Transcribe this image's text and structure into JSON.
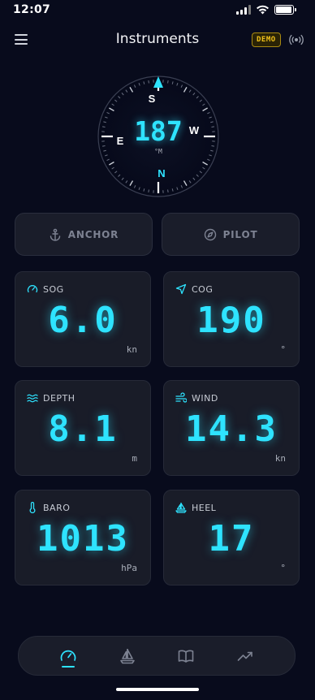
{
  "status_bar": {
    "time": "12:07",
    "icons": [
      "signal-icon",
      "wifi-icon",
      "battery-icon"
    ],
    "battery_level": 0.95
  },
  "header": {
    "title": "Instruments",
    "badge": "DEMO",
    "icons": [
      "menu-icon",
      "radio-broadcast-icon"
    ]
  },
  "compass": {
    "heading": "187",
    "unit": "°M",
    "cardinals": {
      "north": "N",
      "south": "S",
      "east": "E",
      "west": "W"
    }
  },
  "modes": [
    {
      "label": "ANCHOR",
      "icon": "anchor-icon"
    },
    {
      "label": "PILOT",
      "icon": "compass-icon"
    }
  ],
  "instruments": [
    {
      "label": "SOG",
      "icon": "speedometer-icon",
      "value": "6.0",
      "unit": "kn"
    },
    {
      "label": "COG",
      "icon": "navigation-arrow-icon",
      "value": "190",
      "unit": "°"
    },
    {
      "label": "DEPTH",
      "icon": "waves-icon",
      "value": "8.1",
      "unit": "m"
    },
    {
      "label": "WIND",
      "icon": "wind-icon",
      "value": "14.3",
      "unit": "kn"
    },
    {
      "label": "BARO",
      "icon": "thermometer-icon",
      "value": "1013",
      "unit": "hPa"
    },
    {
      "label": "HEEL",
      "icon": "sailboat-icon",
      "value": "17",
      "unit": "°"
    }
  ],
  "nav": {
    "items": [
      "gauge-icon",
      "sailboat-icon",
      "book-icon",
      "trending-up-icon"
    ],
    "active": "gauge-icon"
  },
  "colors": {
    "background": "#080b1c",
    "accent": "#2ee3ff",
    "card": "#191c28",
    "badge": "#f2c21a"
  }
}
